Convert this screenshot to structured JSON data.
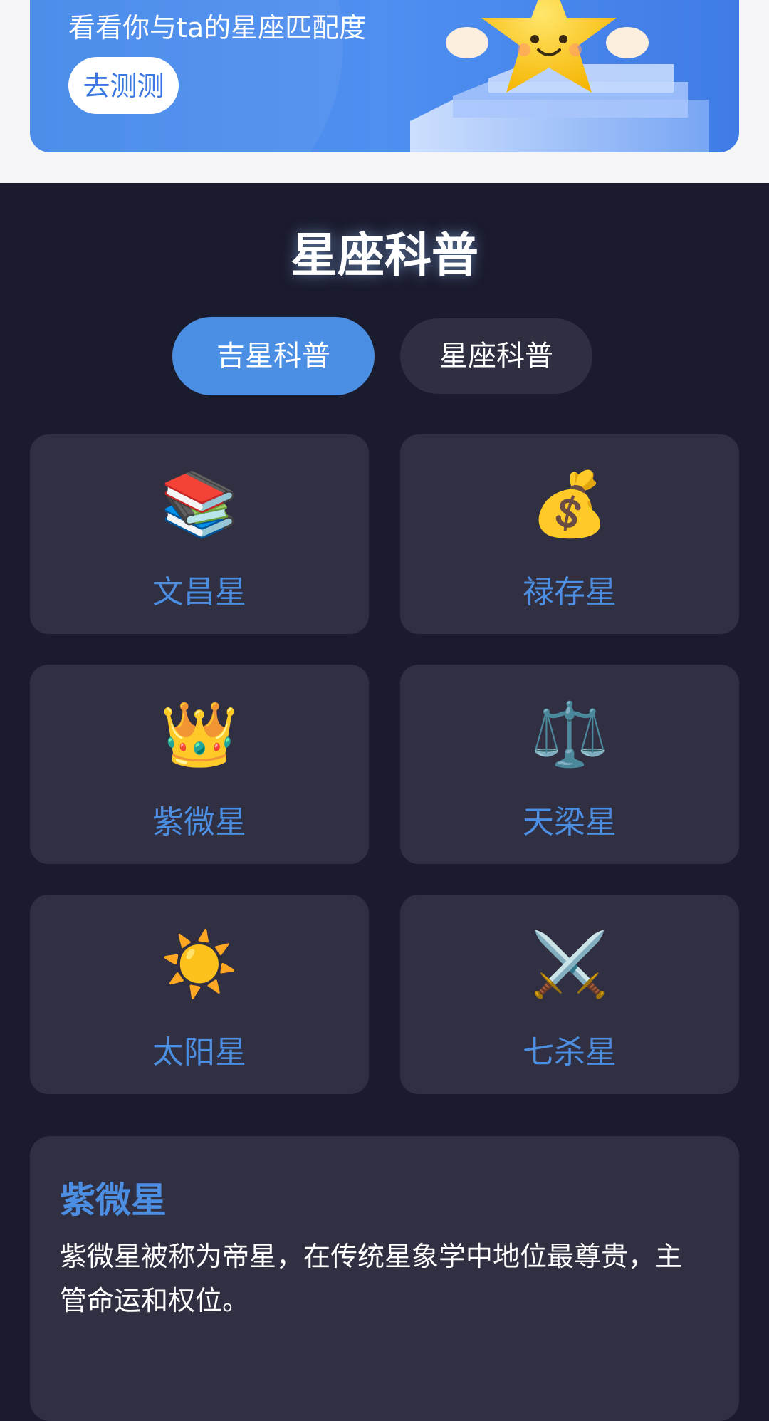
{
  "banner": {
    "subtitle": "看看你与ta的星座匹配度",
    "button_label": "去测测"
  },
  "section": {
    "title": "星座科普"
  },
  "tabs": [
    {
      "label": "吉星科普",
      "active": true
    },
    {
      "label": "星座科普",
      "active": false
    }
  ],
  "stars": [
    {
      "emoji": "📚",
      "name": "文昌星",
      "icon": "books-icon"
    },
    {
      "emoji": "💰",
      "name": "禄存星",
      "icon": "money-bag-icon"
    },
    {
      "emoji": "👑",
      "name": "紫微星",
      "icon": "crown-icon"
    },
    {
      "emoji": "⚖️",
      "name": "天梁星",
      "icon": "scales-icon"
    },
    {
      "emoji": "☀️",
      "name": "太阳星",
      "icon": "sun-icon"
    },
    {
      "emoji": "⚔️",
      "name": "七杀星",
      "icon": "crossed-swords-icon"
    }
  ],
  "detail": {
    "title": "紫微星",
    "description": "紫微星被称为帝星，在传统星象学中地位最尊贵，主管命运和权位。"
  },
  "colors": {
    "background": "#1b1b2e",
    "card": "#303042",
    "accent": "#4a8fe4",
    "banner": "#4287ea"
  }
}
